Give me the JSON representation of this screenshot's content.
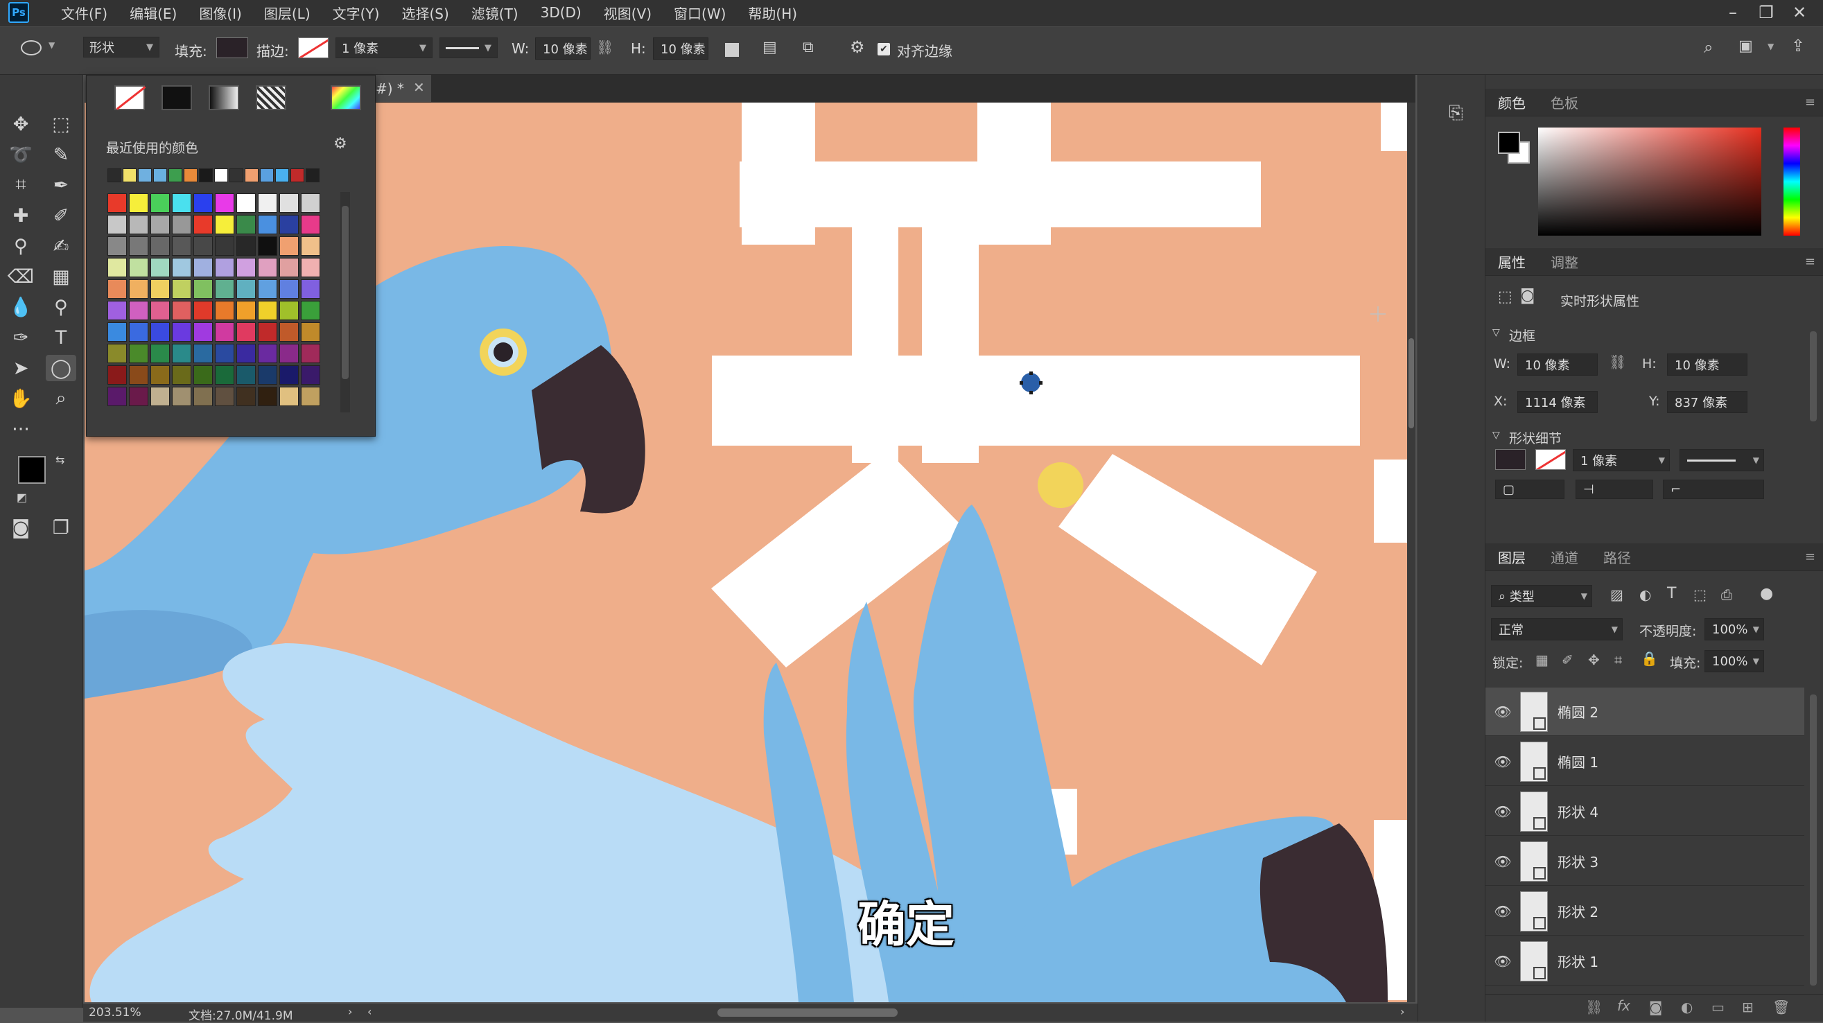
{
  "app": {
    "logo": "Ps",
    "menu": [
      "文件(F)",
      "编辑(E)",
      "图像(I)",
      "图层(L)",
      "文字(Y)",
      "选择(S)",
      "滤镜(T)",
      "3D(D)",
      "视图(V)",
      "窗口(W)",
      "帮助(H)"
    ],
    "window_controls": [
      "minimize-icon",
      "restore-icon",
      "close-icon"
    ]
  },
  "options": {
    "mode": "形状",
    "fill_label": "填充:",
    "stroke_label": "描边:",
    "stroke_width": "1 像素",
    "w_label": "W:",
    "w_value": "10 像素",
    "h_label": "H:",
    "h_value": "10 像素",
    "align_edges": "对齐边缘",
    "fill_color": "#2a2228"
  },
  "document": {
    "tab_title": "#) *",
    "zoom": "203.51%",
    "doc_info": "文档:27.0M/41.9M",
    "subtitle": "确定"
  },
  "swatch_popup": {
    "recent_label": "最近使用的颜色",
    "recent": [
      "#2b2b2b",
      "#f0e06a",
      "#6fb0e0",
      "#6ab0e0",
      "#3d9e4e",
      "#e88a3a",
      "#1a1a1a",
      "#ffffff",
      "#333333",
      "#f0a070",
      "#5aa0e0",
      "#4ab0ee",
      "#c02a2a",
      "#202020"
    ],
    "grid": [
      [
        "#e83a2a",
        "#f6ee3a",
        "#4ad05a",
        "#4ae0ee",
        "#2a40ee",
        "#e83ae8",
        "#ffffff",
        "#f0f0f0",
        "#e0e0e0",
        "#d0d0d0"
      ],
      [
        "#c8c8c8",
        "#b8b8b8",
        "#a8a8a8",
        "#989898",
        "#e83a2a",
        "#f6ee3a",
        "#3a8a4a",
        "#4a90e0",
        "#2a40a0",
        "#e83a8a"
      ],
      [
        "#888888",
        "#787878",
        "#686868",
        "#585858",
        "#484848",
        "#383838",
        "#282828",
        "#101010",
        "#f0a070",
        "#f0c08a"
      ],
      [
        "#e0e8a0",
        "#c0e0a0",
        "#a0d8c0",
        "#a0c8e0",
        "#a0b0e0",
        "#b0a0e0",
        "#d0a0e0",
        "#e0a0c0",
        "#e0a0a0",
        "#f0b0b0"
      ],
      [
        "#e88a5a",
        "#f0b060",
        "#f0d060",
        "#c0d060",
        "#80c060",
        "#60b090",
        "#60b0c0",
        "#60a0e0",
        "#6080e0",
        "#8060e0"
      ],
      [
        "#a060e0",
        "#d060c0",
        "#e06090",
        "#e06060",
        "#e03a2a",
        "#e87a2a",
        "#f0a02a",
        "#f0d02a",
        "#a0c02a",
        "#3aa03a"
      ],
      [
        "#3a8ae0",
        "#3a6ae0",
        "#3a4ae0",
        "#6a3ae0",
        "#a03ae0",
        "#d03aa0",
        "#e03a60",
        "#c02a2a",
        "#c05a2a",
        "#c08a2a"
      ],
      [
        "#8a8a2a",
        "#4a8a2a",
        "#2a8a4a",
        "#2a8a8a",
        "#2a6aa0",
        "#2a4aa0",
        "#3a2aa0",
        "#6a2aa0",
        "#8a2a8a",
        "#a02a5a"
      ],
      [
        "#8a1a1a",
        "#8a4a1a",
        "#8a6a1a",
        "#6a6a1a",
        "#3a6a1a",
        "#1a6a3a",
        "#1a5a6a",
        "#1a3a6a",
        "#1a1a6a",
        "#3a1a6a"
      ],
      [
        "#5a1a6a",
        "#6a1a4a",
        "#c0b090",
        "#a09070",
        "#807050",
        "#605040",
        "#403020",
        "#302010",
        "#e0c080",
        "#c0a060"
      ]
    ]
  },
  "right_panels": {
    "color_tabs": [
      "颜色",
      "色板"
    ],
    "props_tabs": [
      "属性",
      "调整"
    ],
    "live_shape": "实时形状属性",
    "bbox_section": "边框",
    "w_label": "W:",
    "w": "10 像素",
    "h_label": "H:",
    "h": "10 像素",
    "x_label": "X:",
    "x": "1114 像素",
    "y_label": "Y:",
    "y": "837 像素",
    "shape_detail": "形状细节",
    "stroke": "1 像素",
    "layers_tabs": [
      "图层",
      "通道",
      "路径"
    ],
    "filter_kind": "类型",
    "blend": "正常",
    "opacity_label": "不透明度:",
    "opacity": "100%",
    "lock_label": "锁定:",
    "fill_label": "填充:",
    "fill": "100%",
    "layers": [
      {
        "name": "椭圆 2",
        "selected": true
      },
      {
        "name": "椭圆 1",
        "selected": false
      },
      {
        "name": "形状 4",
        "selected": false
      },
      {
        "name": "形状 3",
        "selected": false
      },
      {
        "name": "形状 2",
        "selected": false
      },
      {
        "name": "形状 1",
        "selected": false
      }
    ]
  },
  "colors": {
    "accent": "#31a8ff",
    "artwork_bg": "#efae8a",
    "parrot_blue": "#79b8e6",
    "wing_light": "#b9dcf6",
    "beak": "#3a2c32",
    "dot_yellow": "#f2d45a"
  }
}
